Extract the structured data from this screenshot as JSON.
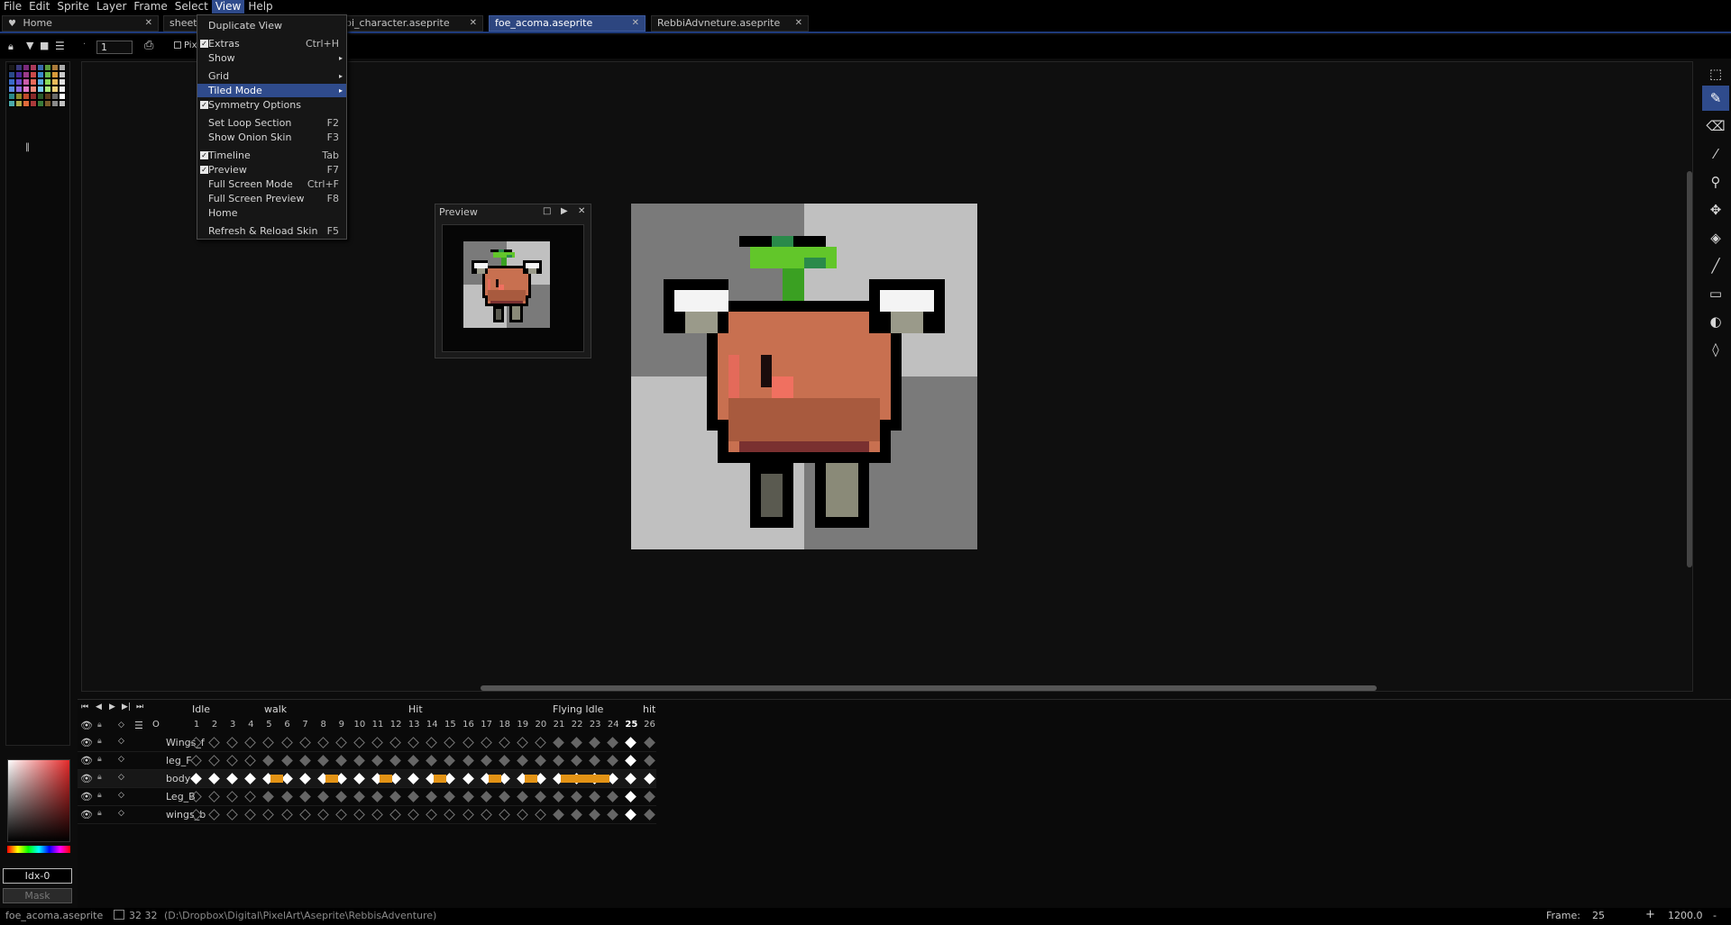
{
  "menubar": {
    "items": [
      "File",
      "Edit",
      "Sprite",
      "Layer",
      "Frame",
      "Select",
      "View",
      "Help"
    ],
    "active": "View"
  },
  "tabs": [
    {
      "label": "Home",
      "icon": "heart-icon"
    },
    {
      "label": "sheet",
      "truncated": true
    },
    {
      "label": "bi_character.aseprite"
    },
    {
      "label": "foe_acoma.aseprite",
      "active": true
    },
    {
      "label": "RebbiAdvneture.aseprite"
    }
  ],
  "context": {
    "brush_size": "1",
    "pixel_perfect_label": "Pix"
  },
  "view_menu": {
    "items": [
      {
        "label": "Duplicate View"
      },
      {
        "label": "Extras",
        "shortcut": "Ctrl+H",
        "checked": true
      },
      {
        "label": "Show",
        "submenu": true
      },
      {
        "label": "Grid",
        "submenu": true
      },
      {
        "label": "Tiled Mode",
        "submenu": true,
        "highlighted": true
      },
      {
        "label": "Symmetry Options",
        "checked": true
      },
      {
        "label": "Set Loop Section",
        "shortcut": "F2"
      },
      {
        "label": "Show Onion Skin",
        "shortcut": "F3"
      },
      {
        "label": "Timeline",
        "shortcut": "Tab",
        "checked": true
      },
      {
        "label": "Preview",
        "shortcut": "F7",
        "checked": true
      },
      {
        "label": "Full Screen Mode",
        "shortcut": "Ctrl+F"
      },
      {
        "label": "Full Screen Preview",
        "shortcut": "F8"
      },
      {
        "label": "Home"
      },
      {
        "label": "Refresh & Reload Skin",
        "shortcut": "F5"
      }
    ]
  },
  "preview": {
    "title": "Preview"
  },
  "color_panel": {
    "index_label": "Idx-0",
    "mask_label": "Mask"
  },
  "tools": [
    "marquee-icon",
    "pencil-icon",
    "eraser-icon",
    "eyedropper-icon",
    "zoom-icon",
    "move-icon",
    "paint-bucket-icon",
    "line-icon",
    "rectangle-icon",
    "blur-icon",
    "ink-drop-icon"
  ],
  "timeline": {
    "tags": [
      {
        "label": "Idle",
        "start": 1
      },
      {
        "label": "walk",
        "start": 5
      },
      {
        "label": "Hit",
        "start": 13
      },
      {
        "label": "Flying Idle",
        "start": 21
      },
      {
        "label": "hit",
        "start": 26
      }
    ],
    "frame_count": 26,
    "current_frame": 25,
    "header_icons": [
      "eye-icon",
      "lock-icon",
      "diamond-icon",
      "menu-icon",
      "onion-icon"
    ],
    "layers": [
      {
        "name": "Wings_f",
        "cels": "empty:1-20;key:21-26"
      },
      {
        "name": "leg_F",
        "cels": "empty:1-4;key:5-26"
      },
      {
        "name": "body",
        "cels": "key:1-26",
        "selected": true
      },
      {
        "name": "Leg_B",
        "cels": "empty:1-4;key:5-26"
      },
      {
        "name": "wings_b",
        "cels": "empty:1-20;key:21-26"
      }
    ]
  },
  "status": {
    "file": "foe_acoma.aseprite",
    "size": "32 32",
    "path": "(D:\\Dropbox\\Digital\\PixelArt\\Aseprite\\RebbisAdventure)",
    "frame_label": "Frame:",
    "frame_value": "25",
    "zoom": "1200.0"
  },
  "colors": {
    "accent": "#2f4b8c",
    "body_orange": "#c87050",
    "leaf_green": "#62c62a",
    "link_orange": "#e39315"
  }
}
